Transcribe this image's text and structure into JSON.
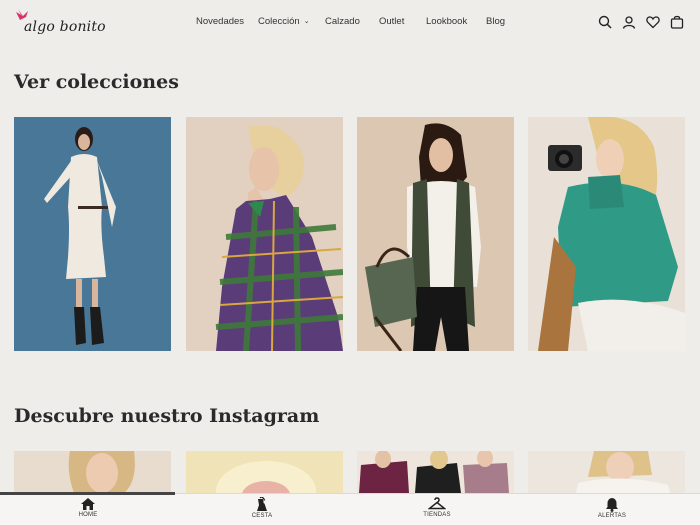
{
  "brand": {
    "name": "algo bonito",
    "accent_color": "#d6336c"
  },
  "nav": {
    "items": [
      "Novedades",
      "Colección",
      "Calzado",
      "Outlet",
      "Lookbook",
      "Blog"
    ]
  },
  "header_icons": [
    "search-icon",
    "user-icon",
    "heart-icon",
    "bag-icon"
  ],
  "sections": {
    "collections_title": "Ver colecciones",
    "instagram_title": "Descubre nuestro Instagram"
  },
  "bottom_nav": {
    "items": [
      {
        "label": "HOME",
        "icon": "home-icon"
      },
      {
        "label": "CESTA",
        "icon": "cart-icon"
      },
      {
        "label": "TIENDAS",
        "icon": "hanger-icon"
      },
      {
        "label": "ALERTAS",
        "icon": "bell-icon"
      }
    ],
    "active_index": 0
  }
}
